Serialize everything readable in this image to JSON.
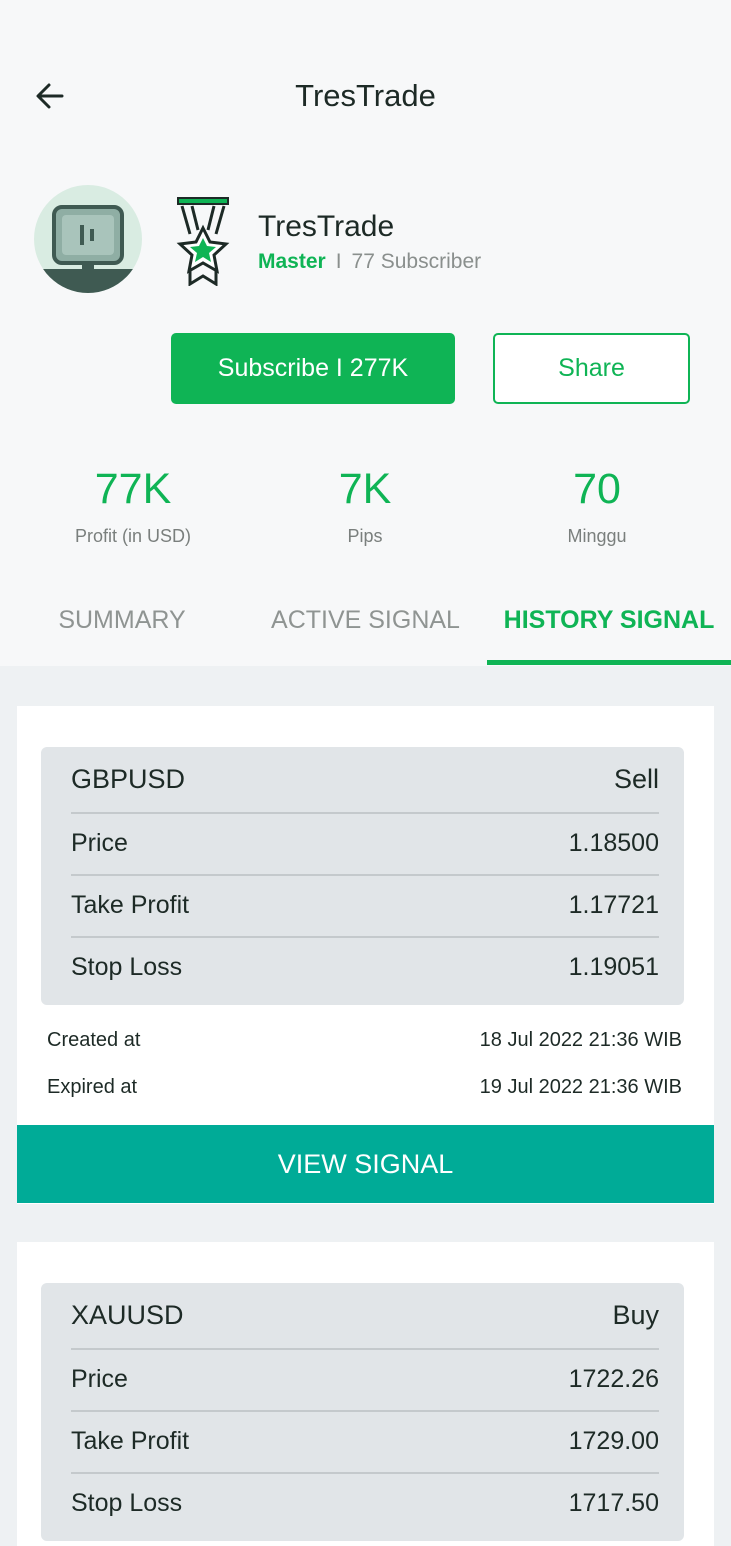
{
  "app": {
    "title": "TresTrade"
  },
  "profile": {
    "name": "TresTrade",
    "level": "Master",
    "separator": "I",
    "subscribers": "77 Subscriber"
  },
  "actions": {
    "subscribe_label": "Subscribe I 277K",
    "share_label": "Share"
  },
  "stats": [
    {
      "value": "77K",
      "label": "Profit (in USD)"
    },
    {
      "value": "7K",
      "label": "Pips"
    },
    {
      "value": "70",
      "label": "Minggu"
    }
  ],
  "tabs": [
    {
      "label": "SUMMARY",
      "active": false
    },
    {
      "label": "ACTIVE SIGNAL",
      "active": false
    },
    {
      "label": "HISTORY SIGNAL",
      "active": true
    }
  ],
  "signals": [
    {
      "pair": "GBPUSD",
      "direction": "Sell",
      "price_label": "Price",
      "price": "1.18500",
      "tp_label": "Take Profit",
      "take_profit": "1.17721",
      "sl_label": "Stop Loss",
      "stop_loss": "1.19051",
      "created_label": "Created at",
      "created_at": "18 Jul 2022 21:36 WIB",
      "expired_label": "Expired at",
      "expired_at": "19 Jul 2022 21:36 WIB",
      "button_label": "VIEW SIGNAL"
    },
    {
      "pair": "XAUUSD",
      "direction": "Buy",
      "price_label": "Price",
      "price": "1722.26",
      "tp_label": "Take Profit",
      "take_profit": "1729.00",
      "sl_label": "Stop Loss",
      "stop_loss": "1717.50"
    }
  ],
  "colors": {
    "accent": "#0fb455",
    "view_button": "#00ab97",
    "card_inner": "#e1e5e8"
  }
}
